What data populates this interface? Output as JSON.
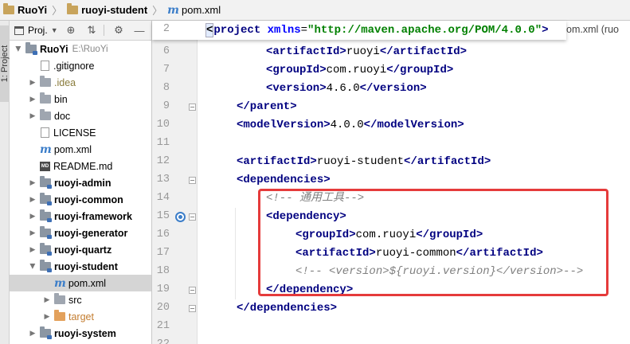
{
  "breadcrumb": {
    "root": "RuoYi",
    "module": "ruoyi-student",
    "file": "pom.xml"
  },
  "tool_strip": {
    "project_tab": "1: Project"
  },
  "project_panel": {
    "title": "Proj.",
    "toolbar_icons": [
      "target-icon",
      "collapse-icon",
      "settings-icon",
      "hide-icon"
    ],
    "tree": [
      {
        "label": "RuoYi",
        "note": "E:\\RuoYi",
        "depth": 0,
        "expanded": true,
        "icon": "module-folder-icon",
        "bold": true
      },
      {
        "label": ".gitignore",
        "depth": 1,
        "icon": "file-icon"
      },
      {
        "label": ".idea",
        "depth": 1,
        "expandable": true,
        "icon": "folder-icon",
        "style": "idea"
      },
      {
        "label": "bin",
        "depth": 1,
        "expandable": true,
        "icon": "folder-icon"
      },
      {
        "label": "doc",
        "depth": 1,
        "expandable": true,
        "icon": "folder-icon"
      },
      {
        "label": "LICENSE",
        "depth": 1,
        "icon": "file-icon"
      },
      {
        "label": "pom.xml",
        "depth": 1,
        "icon": "maven-icon"
      },
      {
        "label": "README.md",
        "depth": 1,
        "icon": "markdown-icon"
      },
      {
        "label": "ruoyi-admin",
        "depth": 1,
        "expandable": true,
        "icon": "module-folder-icon",
        "bold": true
      },
      {
        "label": "ruoyi-common",
        "depth": 1,
        "expandable": true,
        "icon": "module-folder-icon",
        "bold": true
      },
      {
        "label": "ruoyi-framework",
        "depth": 1,
        "expandable": true,
        "icon": "module-folder-icon",
        "bold": true
      },
      {
        "label": "ruoyi-generator",
        "depth": 1,
        "expandable": true,
        "icon": "module-folder-icon",
        "bold": true
      },
      {
        "label": "ruoyi-quartz",
        "depth": 1,
        "expandable": true,
        "icon": "module-folder-icon",
        "bold": true
      },
      {
        "label": "ruoyi-student",
        "depth": 1,
        "expandable": true,
        "expanded": true,
        "icon": "module-folder-icon",
        "bold": true
      },
      {
        "label": "pom.xml",
        "depth": 2,
        "icon": "maven-icon",
        "selected": true
      },
      {
        "label": "src",
        "depth": 2,
        "expandable": true,
        "icon": "folder-icon"
      },
      {
        "label": "target",
        "depth": 2,
        "expandable": true,
        "icon": "excluded-folder-icon",
        "style": "target"
      },
      {
        "label": "ruoyi-system",
        "depth": 1,
        "expandable": true,
        "icon": "module-folder-icon",
        "bold": true
      }
    ]
  },
  "editor": {
    "sticky_line": {
      "number": "2",
      "tag_open": "<project",
      "attr": "xmlns",
      "value": "\"http://maven.apache.org/POM/4.0.0\"",
      "tag_close": ">",
      "overflow_text": "om.xml (ruo"
    },
    "lines": [
      {
        "n": "6",
        "indent": 2,
        "parts": [
          [
            "tag",
            "<artifactId>"
          ],
          [
            "txt",
            "ruoyi"
          ],
          [
            "tag",
            "</artifactId>"
          ]
        ]
      },
      {
        "n": "7",
        "indent": 2,
        "parts": [
          [
            "tag",
            "<groupId>"
          ],
          [
            "txt",
            "com.ruoyi"
          ],
          [
            "tag",
            "</groupId>"
          ]
        ]
      },
      {
        "n": "8",
        "indent": 2,
        "parts": [
          [
            "tag",
            "<version>"
          ],
          [
            "txt",
            "4.6.0"
          ],
          [
            "tag",
            "</version>"
          ]
        ]
      },
      {
        "n": "9",
        "indent": 1,
        "parts": [
          [
            "tag",
            "</parent>"
          ]
        ],
        "fold": true
      },
      {
        "n": "10",
        "indent": 1,
        "parts": [
          [
            "tag",
            "<modelVersion>"
          ],
          [
            "txt",
            "4.0.0"
          ],
          [
            "tag",
            "</modelVersion>"
          ]
        ]
      },
      {
        "n": "11",
        "indent": 0,
        "parts": []
      },
      {
        "n": "12",
        "indent": 1,
        "parts": [
          [
            "tag",
            "<artifactId>"
          ],
          [
            "txt",
            "ruoyi-student"
          ],
          [
            "tag",
            "</artifactId>"
          ]
        ]
      },
      {
        "n": "13",
        "indent": 1,
        "parts": [
          [
            "tag",
            "<dependencies>"
          ]
        ],
        "fold": true
      },
      {
        "n": "14",
        "indent": 2,
        "parts": [
          [
            "cmt",
            "<!-- 通用工具-->"
          ]
        ]
      },
      {
        "n": "15",
        "indent": 2,
        "parts": [
          [
            "tag",
            "<dependency>"
          ]
        ],
        "fold": true,
        "breakpoint": true
      },
      {
        "n": "16",
        "indent": 3,
        "parts": [
          [
            "tag",
            "<groupId>"
          ],
          [
            "txt",
            "com.ruoyi"
          ],
          [
            "tag",
            "</groupId>"
          ]
        ]
      },
      {
        "n": "17",
        "indent": 3,
        "parts": [
          [
            "tag",
            "<artifactId>"
          ],
          [
            "txt",
            "ruoyi-common"
          ],
          [
            "tag",
            "</artifactId>"
          ]
        ]
      },
      {
        "n": "18",
        "indent": 3,
        "parts": [
          [
            "cmt",
            "<!-- <version>${ruoyi.version}</version>-->"
          ]
        ]
      },
      {
        "n": "19",
        "indent": 2,
        "parts": [
          [
            "tag",
            "</dependency>"
          ]
        ],
        "fold": true
      },
      {
        "n": "20",
        "indent": 1,
        "parts": [
          [
            "tag",
            "</dependencies>"
          ]
        ],
        "fold": true
      },
      {
        "n": "21",
        "indent": 0,
        "parts": []
      },
      {
        "n": "22",
        "indent": 0,
        "parts": []
      }
    ]
  },
  "colors": {
    "highlight_border": "#e53b3b",
    "tag": "#000080",
    "attr": "#0000ff",
    "value": "#008000",
    "comment": "#808080"
  }
}
